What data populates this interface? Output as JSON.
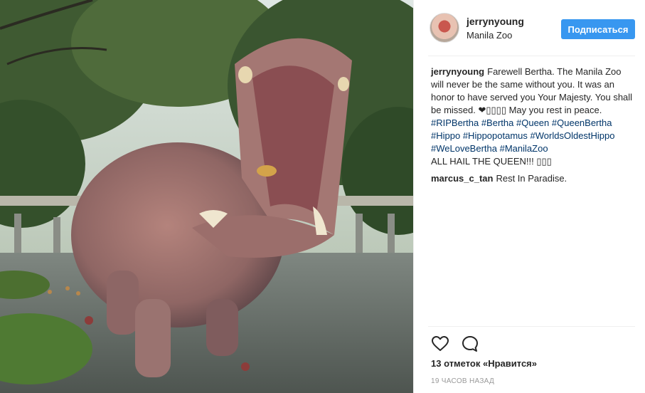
{
  "post": {
    "username": "jerrynyoung",
    "location": "Manila Zoo",
    "follow_label": "Подписаться"
  },
  "caption": {
    "user": "jerrynyoung",
    "text": "Farewell Bertha. The Manila Zoo will never be the same without you. It was an honor to have served you Your Majesty. You shall be missed. ❤▯▯▯▯ May you rest in peace.",
    "hashtags": [
      "#RIPBertha",
      "#Bertha",
      "#Queen",
      "#QueenBertha",
      "#Hippo",
      "#Hippopotamus",
      "#WorldsOldestHippo",
      "#WeLoveBertha",
      "#ManilaZoo"
    ],
    "closing": "ALL HAIL THE QUEEN!!! ▯▯▯"
  },
  "comments": [
    {
      "user": "marcus_c_tan",
      "text": "Rest In Paradise."
    }
  ],
  "actions": {
    "like_icon": "heart-icon",
    "comment_icon": "comment-icon"
  },
  "likes_text": "13 отметок «Нравится»",
  "timestamp": "19 ЧАСОВ НАЗАД",
  "colors": {
    "follow_button": "#3897f0",
    "hashtag": "#003569",
    "muted": "#999999"
  }
}
